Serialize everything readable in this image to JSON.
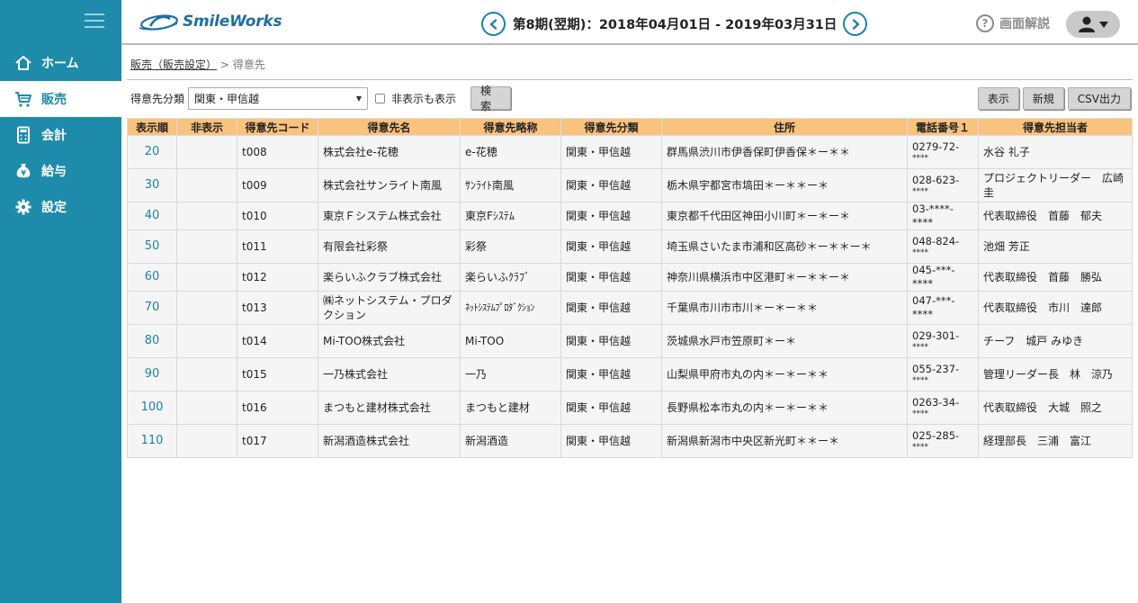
{
  "app": {
    "logo": "SmileWorks"
  },
  "sidebar": {
    "items": [
      {
        "label": "ホーム",
        "icon": "home-icon"
      },
      {
        "label": "販売",
        "icon": "cart-icon"
      },
      {
        "label": "会計",
        "icon": "calculator-icon"
      },
      {
        "label": "給与",
        "icon": "yen-bag-icon"
      },
      {
        "label": "設定",
        "icon": "gear-icon"
      }
    ],
    "active_index": 1
  },
  "header": {
    "period": "第8期(翌期)：2018年04月01日 - 2019年03月31日",
    "help": "画面解説"
  },
  "breadcrumb": {
    "parent": "販売（販売設定）",
    "separator": " > ",
    "current": "得意先"
  },
  "filter": {
    "label": "得意先分類",
    "selected": "関東・甲信越",
    "checkbox_label": "非表示も表示",
    "search_label": "検索"
  },
  "actions": {
    "show": "表示",
    "new": "新規",
    "csv": "CSV出力"
  },
  "table": {
    "columns": [
      "表示順",
      "非表示",
      "得意先コード",
      "得意先名",
      "得意先略称",
      "得意先分類",
      "住所",
      "電話番号１",
      "得意先担当者"
    ],
    "rows": [
      {
        "order": "20",
        "hidden": "",
        "code": "t008",
        "name": "株式会社e-花穂",
        "short": "e-花穂",
        "category": "関東・甲信越",
        "address": "群馬県渋川市伊香保町伊香保＊ー＊＊",
        "phone": "0279-72-",
        "phone2": "****",
        "contact": "水谷 礼子"
      },
      {
        "order": "30",
        "hidden": "",
        "code": "t009",
        "name": "株式会社サンライト南風",
        "short": "ｻﾝﾗｲﾄ南風",
        "category": "関東・甲信越",
        "address": "栃木県宇都宮市塙田＊ー＊＊ー＊",
        "phone": "028-623-",
        "phone2": "****",
        "contact": "プロジェクトリーダー　広崎　圭"
      },
      {
        "order": "40",
        "hidden": "",
        "code": "t010",
        "name": "東京Ｆシステム株式会社",
        "short": "東京Fｼｽﾃﾑ",
        "category": "関東・甲信越",
        "address": "東京都千代田区神田小川町＊ー＊ー＊",
        "phone": "03-****-****",
        "phone2": "",
        "contact": "代表取締役　首藤　郁夫"
      },
      {
        "order": "50",
        "hidden": "",
        "code": "t011",
        "name": "有限会社彩祭",
        "short": "彩祭",
        "category": "関東・甲信越",
        "address": "埼玉県さいたま市浦和区高砂＊ー＊＊ー＊",
        "phone": "048-824-",
        "phone2": "****",
        "contact": "池畑 芳正"
      },
      {
        "order": "60",
        "hidden": "",
        "code": "t012",
        "name": "楽らいふクラブ株式会社",
        "short": "楽らいふｸﾗﾌﾞ",
        "category": "関東・甲信越",
        "address": "神奈川県横浜市中区港町＊ー＊＊ー＊",
        "phone": "045-***-****",
        "phone2": "",
        "contact": "代表取締役　首藤　勝弘"
      },
      {
        "order": "70",
        "hidden": "",
        "code": "t013",
        "name": "㈱ネットシステム・プロダクション",
        "short": "ﾈｯﾄｼｽﾃﾑﾌﾟﾛﾀﾞｸｼｮﾝ",
        "category": "関東・甲信越",
        "address": "千葉県市川市市川＊ー＊ー＊＊",
        "phone": "047-***-****",
        "phone2": "",
        "contact": "代表取締役　市川　達郎"
      },
      {
        "order": "80",
        "hidden": "",
        "code": "t014",
        "name": "Mi-TOO株式会社",
        "short": "Mi-TOO",
        "category": "関東・甲信越",
        "address": "茨城県水戸市笠原町＊ー＊",
        "phone": "029-301-",
        "phone2": "****",
        "contact": "チーフ　城戸 みゆき"
      },
      {
        "order": "90",
        "hidden": "",
        "code": "t015",
        "name": "一乃株式会社",
        "short": "一乃",
        "category": "関東・甲信越",
        "address": "山梨県甲府市丸の内＊ー＊ー＊＊",
        "phone": "055-237-",
        "phone2": "****",
        "contact": "管理リーダー長　林　涼乃"
      },
      {
        "order": "100",
        "hidden": "",
        "code": "t016",
        "name": "まつもと建材株式会社",
        "short": "まつもと建材",
        "category": "関東・甲信越",
        "address": "長野県松本市丸の内＊ー＊ー＊＊",
        "phone": "0263-34-",
        "phone2": "****",
        "contact": "代表取締役　大城　照之"
      },
      {
        "order": "110",
        "hidden": "",
        "code": "t017",
        "name": "新潟酒造株式会社",
        "short": "新潟酒造",
        "category": "関東・甲信越",
        "address": "新潟県新潟市中央区新光町＊＊ー＊",
        "phone": "025-285-",
        "phone2": "****",
        "contact": "経理部長　三浦　富江"
      }
    ]
  }
}
